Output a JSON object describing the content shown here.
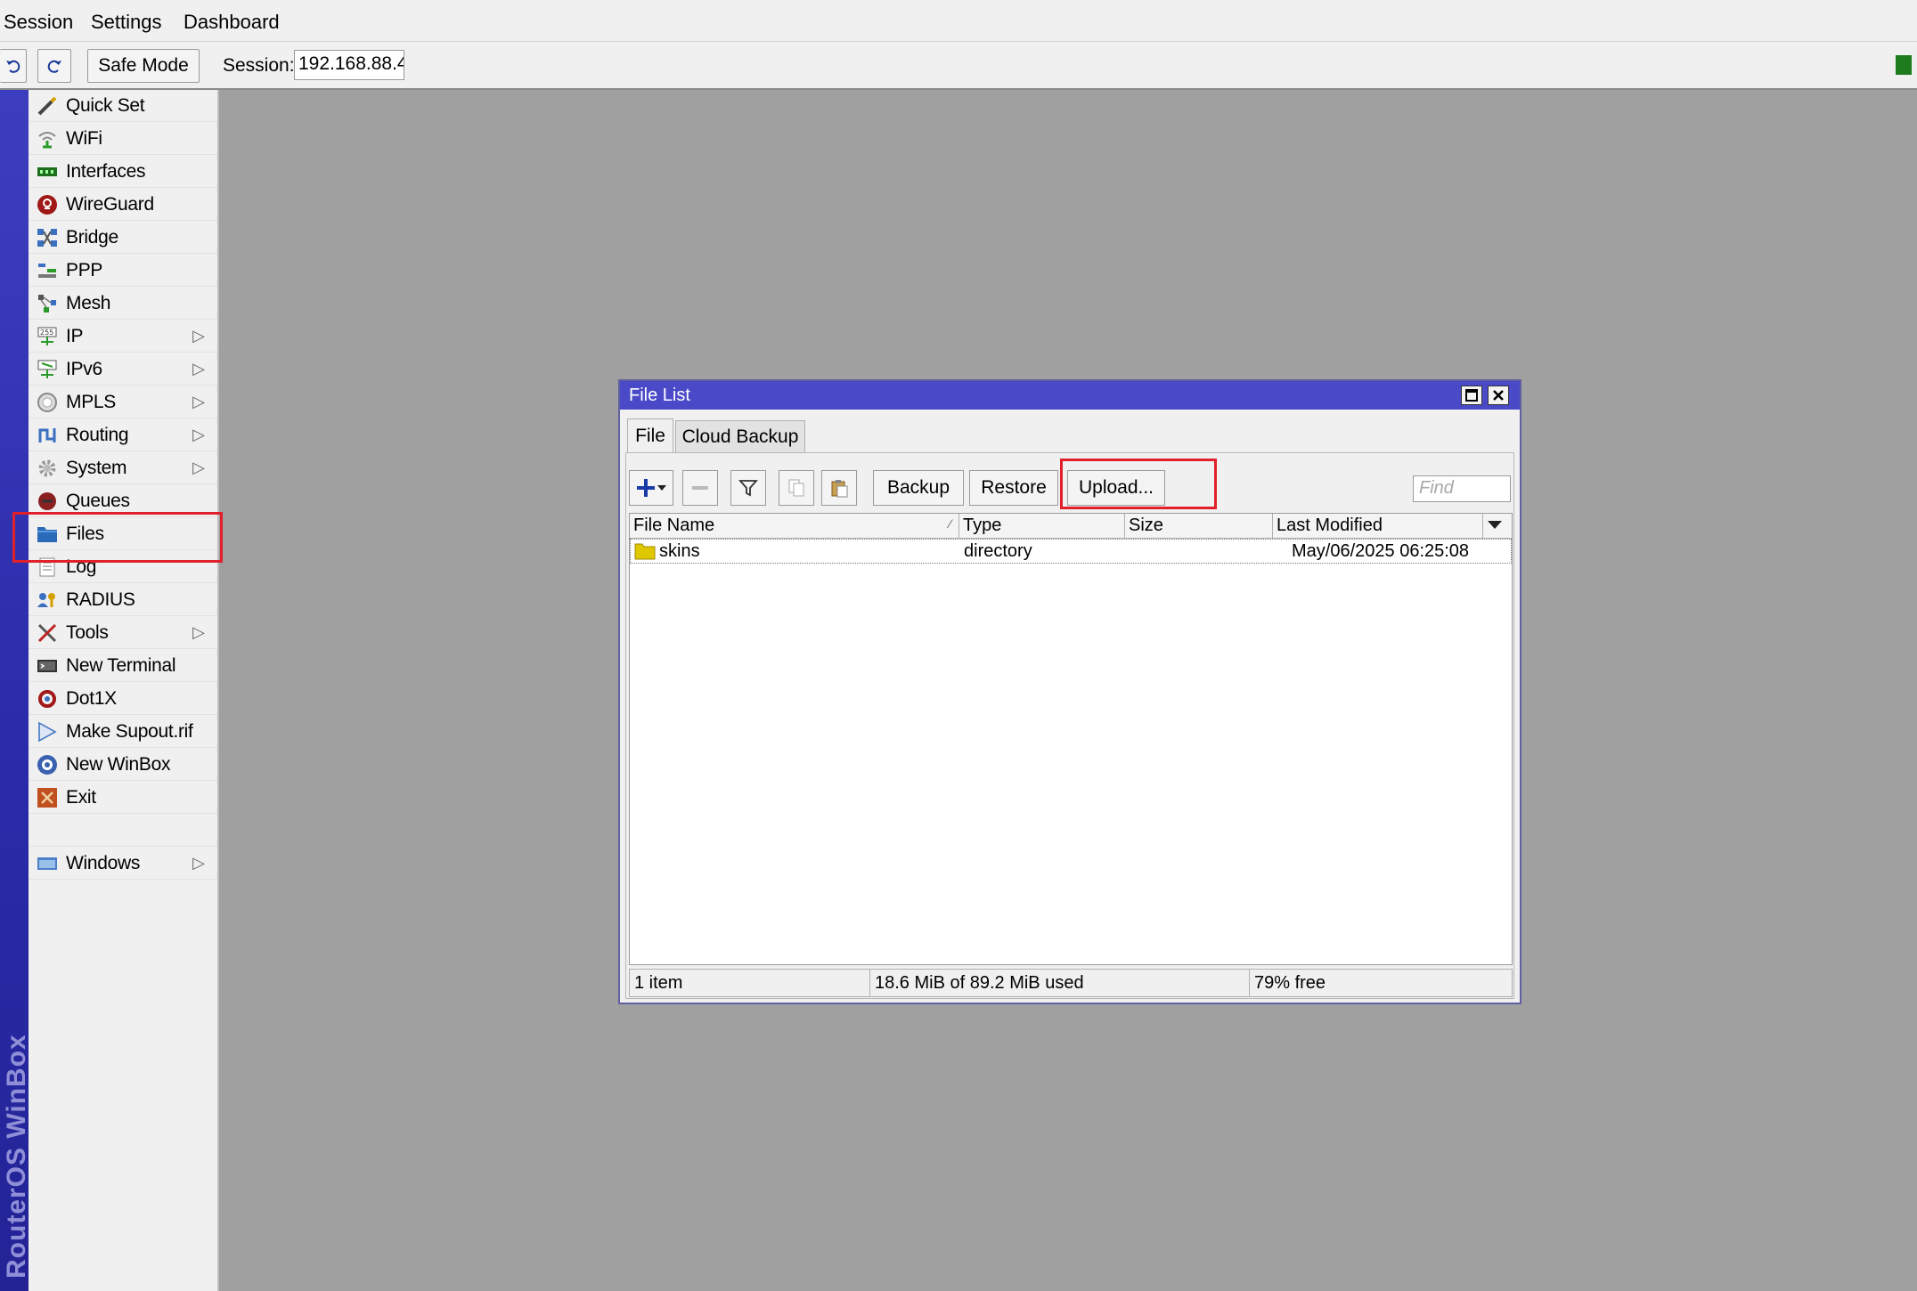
{
  "menubar": {
    "items": [
      "Session",
      "Settings",
      "Dashboard"
    ]
  },
  "toolbar": {
    "undo_icon": "undo-icon",
    "redo_icon": "redo-icon",
    "safe_mode_label": "Safe Mode",
    "session_label": "Session:",
    "session_value": "192.168.88.4"
  },
  "brand": {
    "text": "RouterOS WinBox"
  },
  "sidebar": {
    "items": [
      {
        "label": "Quick Set",
        "icon": "wand-icon",
        "submenu": false
      },
      {
        "label": "WiFi",
        "icon": "wifi-icon",
        "submenu": false
      },
      {
        "label": "Interfaces",
        "icon": "interfaces-icon",
        "submenu": false
      },
      {
        "label": "WireGuard",
        "icon": "wireguard-icon",
        "submenu": false
      },
      {
        "label": "Bridge",
        "icon": "bridge-icon",
        "submenu": false
      },
      {
        "label": "PPP",
        "icon": "ppp-icon",
        "submenu": false
      },
      {
        "label": "Mesh",
        "icon": "mesh-icon",
        "submenu": false
      },
      {
        "label": "IP",
        "icon": "ip-icon",
        "submenu": true
      },
      {
        "label": "IPv6",
        "icon": "ipv6-icon",
        "submenu": true
      },
      {
        "label": "MPLS",
        "icon": "mpls-icon",
        "submenu": true
      },
      {
        "label": "Routing",
        "icon": "routing-icon",
        "submenu": true
      },
      {
        "label": "System",
        "icon": "gear-icon",
        "submenu": true
      },
      {
        "label": "Queues",
        "icon": "queues-icon",
        "submenu": false
      },
      {
        "label": "Files",
        "icon": "folder-icon",
        "submenu": false
      },
      {
        "label": "Log",
        "icon": "log-icon",
        "submenu": false
      },
      {
        "label": "RADIUS",
        "icon": "users-icon",
        "submenu": false
      },
      {
        "label": "Tools",
        "icon": "tools-icon",
        "submenu": true
      },
      {
        "label": "New Terminal",
        "icon": "terminal-icon",
        "submenu": false
      },
      {
        "label": "Dot1X",
        "icon": "dot1x-icon",
        "submenu": false
      },
      {
        "label": "Make Supout.rif",
        "icon": "supout-icon",
        "submenu": false
      },
      {
        "label": "New WinBox",
        "icon": "winbox-icon",
        "submenu": false
      },
      {
        "label": "Exit",
        "icon": "exit-icon",
        "submenu": false
      },
      {
        "label": "Windows",
        "icon": "windows-icon",
        "submenu": true
      }
    ],
    "submenu_arrow": "▷"
  },
  "window": {
    "title": "File List",
    "tabs": [
      "File",
      "Cloud Backup"
    ],
    "buttons": {
      "backup": "Backup",
      "restore": "Restore",
      "upload": "Upload..."
    },
    "find_placeholder": "Find",
    "columns": [
      "File Name",
      "Type",
      "Size",
      "Last Modified"
    ],
    "rows": [
      {
        "name": "skins",
        "type": "directory",
        "size": "",
        "modified": "May/06/2025 06:25:08"
      }
    ],
    "status": {
      "count": "1 item",
      "usage": "18.6 MiB of 89.2 MiB used",
      "free": "79% free"
    }
  },
  "colors": {
    "title_bar": "#4a4ac8",
    "highlight": "#e0202a",
    "status_led": "#1e7c1e"
  }
}
